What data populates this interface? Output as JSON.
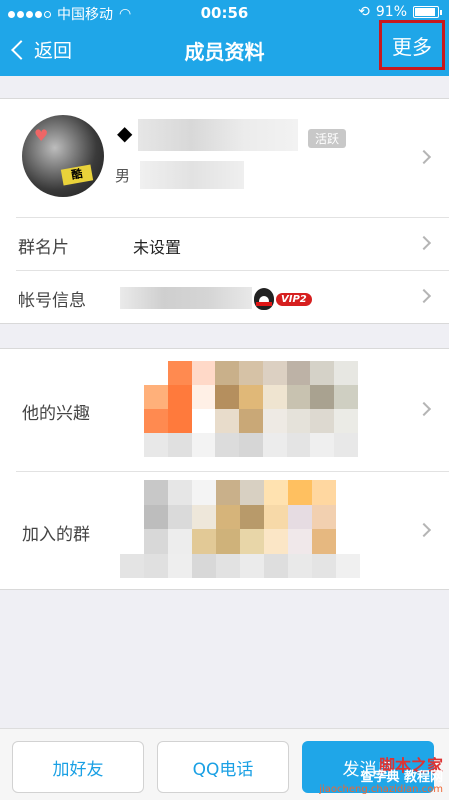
{
  "status": {
    "carrier": "中国移动",
    "time": "00:56",
    "battery": "91%",
    "battery_level": 0.91
  },
  "nav": {
    "back_label": "返回",
    "title": "成员资料",
    "more_label": "更多"
  },
  "profile": {
    "name_prefix": "◆",
    "badge": "活跃",
    "gender": "男",
    "avatar_sign": "酷"
  },
  "rows": {
    "card_label": "群名片",
    "card_value": "未设置",
    "account_label": "帐号信息",
    "vip_label": "VIP2",
    "interests_label": "他的兴趣",
    "groups_label": "加入的群"
  },
  "buttons": {
    "add_friend": "加好友",
    "qq_call": "QQ电话",
    "send_message": "发消息"
  },
  "watermark": {
    "line1": "脚本之家",
    "line2": "查字典 教程网",
    "line3": "jiaocheng.chazidian.com"
  },
  "colors": {
    "accent": "#1fa6e8",
    "highlight_box": "#c8191e"
  }
}
